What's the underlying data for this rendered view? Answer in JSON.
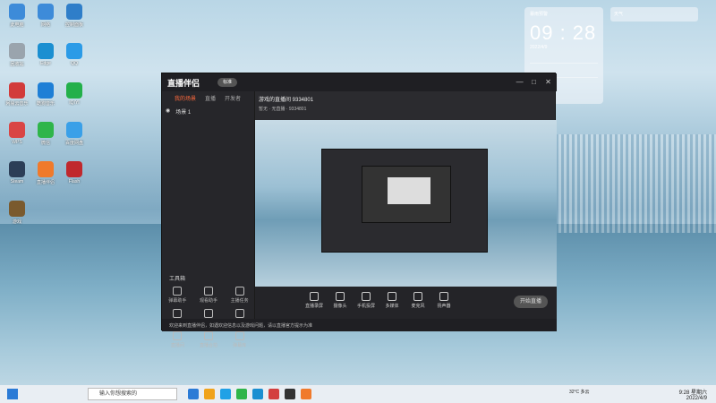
{
  "desktop": {
    "icons": [
      {
        "label": "此电脑",
        "color": "#3d8bd9"
      },
      {
        "label": "网络",
        "color": "#3d8bd9"
      },
      {
        "label": "控制面板",
        "color": "#2f7ec9"
      },
      {
        "label": "回收站",
        "color": "#9aa4ad"
      },
      {
        "label": "Edge",
        "color": "#1b8fd1"
      },
      {
        "label": "QQ",
        "color": "#2b9be7"
      },
      {
        "label": "网易云音乐",
        "color": "#d23b3b"
      },
      {
        "label": "酷狗音乐",
        "color": "#1e7fd6"
      },
      {
        "label": "IQIYI",
        "color": "#23b04a"
      },
      {
        "label": "WPS",
        "color": "#d94545"
      },
      {
        "label": "微信",
        "color": "#2fb54a"
      },
      {
        "label": "百度网盘",
        "color": "#3aa0e8"
      },
      {
        "label": "Steam",
        "color": "#2c3e57"
      },
      {
        "label": "直播伴侣",
        "color": "#f07a2b"
      },
      {
        "label": "Flash",
        "color": "#c0282d"
      },
      {
        "label": "游戏",
        "color": "#7a5a2e"
      }
    ]
  },
  "clock_widget": {
    "location": "暴雨预警",
    "time": "09 : 28",
    "date": "2022/4/9"
  },
  "side_widget": {
    "label": "天气"
  },
  "app": {
    "title": "直播伴侣",
    "badge": "标准",
    "window_buttons": [
      "—",
      "□",
      "✕"
    ],
    "tabs": [
      "我的场景",
      "直播",
      "开发者"
    ],
    "active_tab": "我的场景",
    "scene": {
      "label": "场景 1"
    },
    "tools_title": "工具箱",
    "tools": [
      "弹幕助手",
      "观看助手",
      "主播任务",
      "福利发放",
      "多人连麦",
      "赛事助手",
      "直播间",
      "直播合拍",
      "弹幕库"
    ],
    "live_title": "游戏的直播间 9334801",
    "live_sub": "暂无 · 无直播 · 9334801",
    "bottom_buttons": [
      "直播录屏",
      "摄像头",
      "手机投屏",
      "多媒体",
      "麦克风",
      "扬声器"
    ],
    "start_live": "开始直播",
    "notice": "欢迎来到直播伴侣，如遇欢迎信息以及游戏问题，请以直播官方提示为准"
  },
  "taskbar": {
    "search_placeholder": "输入你想搜索的",
    "weather": "32°C 多云",
    "time": "9:28 星期六",
    "date": "2022/4/9",
    "icon_colors": [
      "#2b7bd6",
      "#f0a31b",
      "#21a1e6",
      "#2fb54a",
      "#1b8fd1",
      "#d33f3f",
      "#333",
      "#f07a2b"
    ]
  }
}
